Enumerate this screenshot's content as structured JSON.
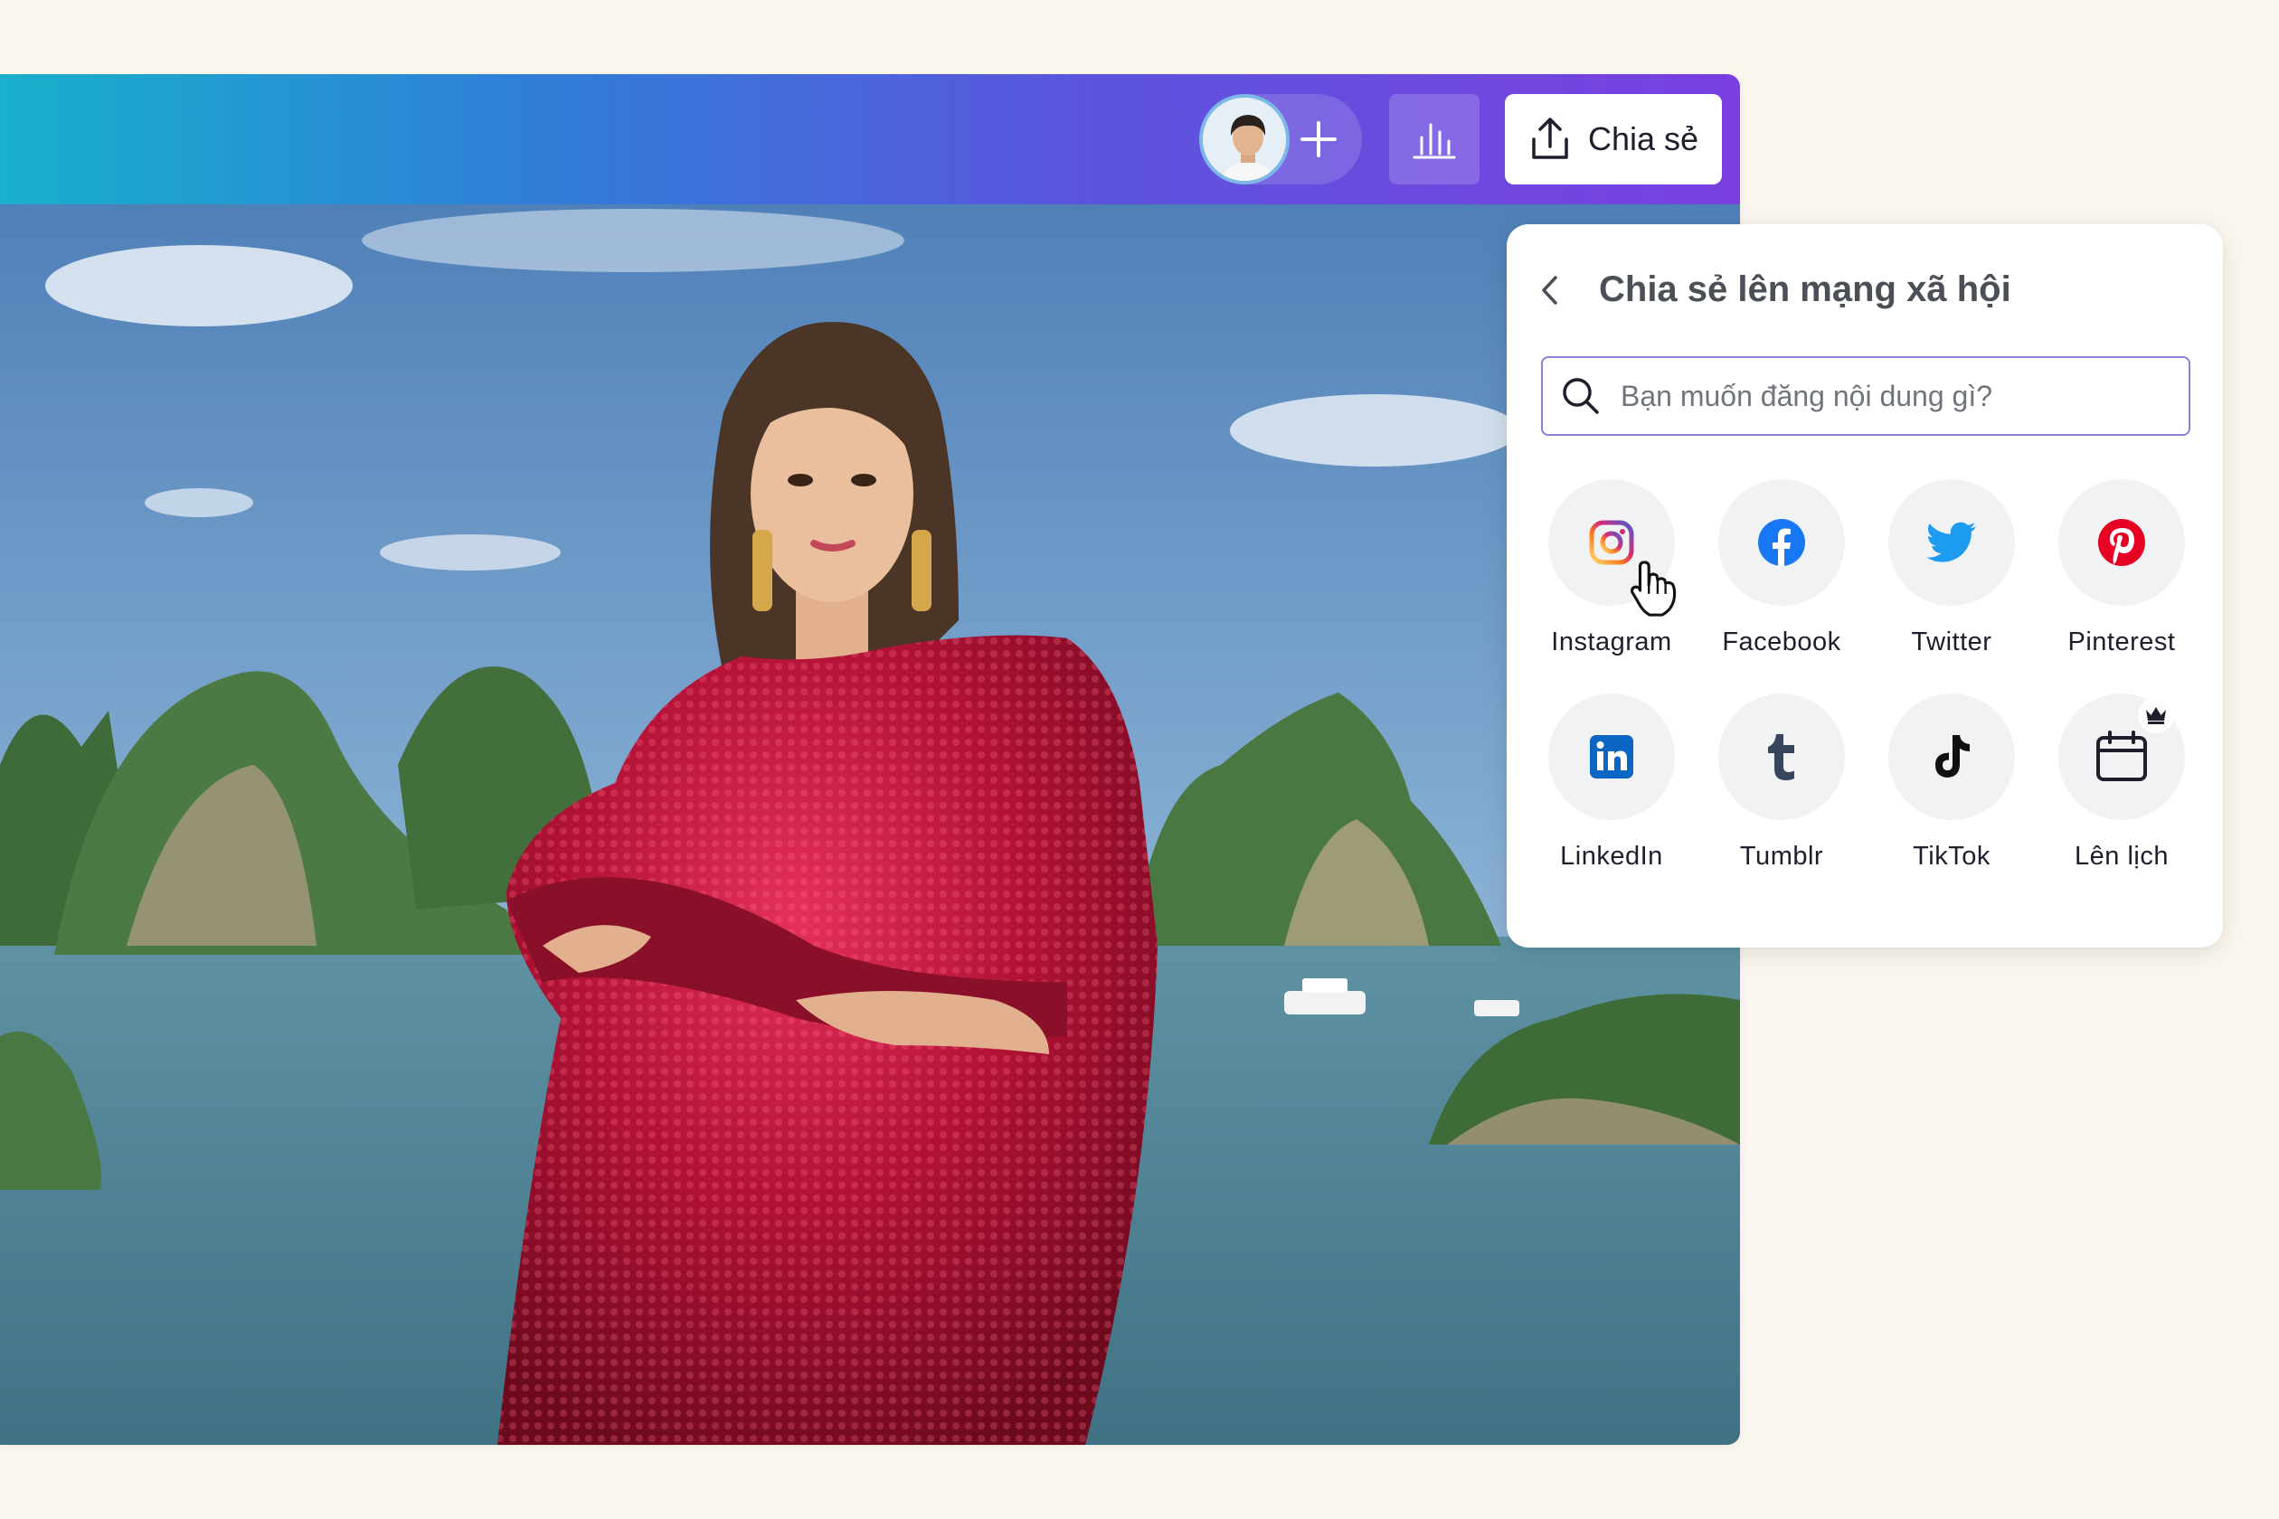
{
  "header": {
    "share_label": "Chia sẻ"
  },
  "share_panel": {
    "title": "Chia sẻ lên mạng xã hội",
    "search_placeholder": "Bạn muốn đăng nội dung gì?",
    "items": [
      {
        "label": "Instagram",
        "icon": "instagram-icon"
      },
      {
        "label": "Facebook",
        "icon": "facebook-icon"
      },
      {
        "label": "Twitter",
        "icon": "twitter-icon"
      },
      {
        "label": "Pinterest",
        "icon": "pinterest-icon"
      },
      {
        "label": "LinkedIn",
        "icon": "linkedin-icon"
      },
      {
        "label": "Tumblr",
        "icon": "tumblr-icon"
      },
      {
        "label": "TikTok",
        "icon": "tiktok-icon"
      },
      {
        "label": "Lên lịch",
        "icon": "calendar-icon",
        "premium": true
      }
    ]
  },
  "colors": {
    "topbar_gradient": [
      "#18b0cc",
      "#7a3fe0"
    ],
    "facebook": "#1877f2",
    "twitter": "#1d9bf0",
    "pinterest": "#e60023",
    "linkedin": "#0a66c2",
    "tumblr": "#36465d"
  }
}
